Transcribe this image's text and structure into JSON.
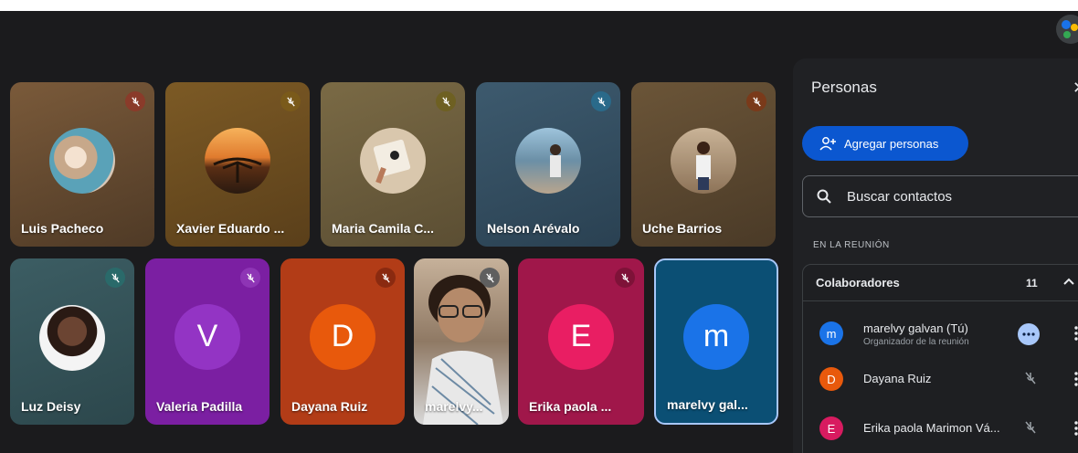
{
  "tiles": [
    {
      "name": "Luis Pacheco",
      "muted": true
    },
    {
      "name": "Xavier Eduardo ...",
      "muted": true
    },
    {
      "name": "Maria Camila C...",
      "muted": true
    },
    {
      "name": "Nelson Arévalo",
      "muted": true
    },
    {
      "name": "Uche Barrios",
      "muted": true
    },
    {
      "name": "Luz Deisy",
      "muted": true
    },
    {
      "name": "Valeria Padilla",
      "initial": "V",
      "muted": true
    },
    {
      "name": "Dayana Ruiz",
      "initial": "D",
      "muted": true
    },
    {
      "name": "marelvy...",
      "muted": true
    },
    {
      "name": "Erika paola ...",
      "initial": "E",
      "muted": true
    },
    {
      "name": "marelvy gal...",
      "initial": "m",
      "muted": false
    }
  ],
  "panel": {
    "title": "Personas",
    "add_people_label": "Agregar personas",
    "search_placeholder": "Buscar contactos",
    "section_label": "EN LA REUNIÓN",
    "group": {
      "name": "Colaboradores",
      "count": "11"
    },
    "people": [
      {
        "initial": "m",
        "name": "marelvy galvan (Tú)",
        "role": "Organizador de la reunión",
        "color": "#1a73e8"
      },
      {
        "initial": "D",
        "name": "Dayana Ruiz",
        "color": "#e8590c"
      },
      {
        "initial": "E",
        "name": "Erika paola Marimon Vá...",
        "color": "#d81b60"
      }
    ]
  },
  "colors": {
    "accent": "#0b57d0",
    "panel_bg": "#202124"
  }
}
